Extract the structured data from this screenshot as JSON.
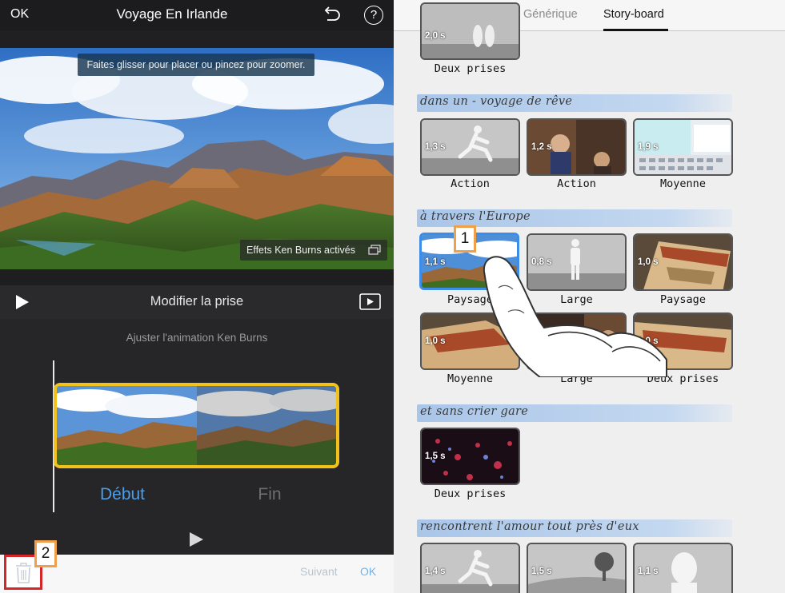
{
  "left": {
    "ok_label": "OK",
    "title": "Voyage En Irlande",
    "hint": "Faites glisser pour placer ou pincez pour zoomer.",
    "kenburns_label": "Effets Ken Burns activés",
    "modify_title": "Modifier la prise",
    "adjust_label": "Ajuster l'animation Ken Burns",
    "debut_label": "Début",
    "fin_label": "Fin",
    "suivant_label": "Suivant",
    "ok2_label": "OK",
    "icons": [
      "undo-icon",
      "help-icon",
      "play-icon",
      "video-preview-icon",
      "layers-icon",
      "trash-icon"
    ]
  },
  "callouts": {
    "one": "1",
    "two": "2"
  },
  "right": {
    "tab_generique": "Générique",
    "tab_storyboard": "Story-board",
    "sections": [
      {
        "title": "dans un - voyage de rêve"
      },
      {
        "title": "à travers l'Europe"
      },
      {
        "title": "et sans crier gare"
      },
      {
        "title": "rencontrent l'amour tout près d'eux"
      }
    ],
    "tiles": [
      {
        "dur": "2,0 s",
        "label": "Deux prises"
      },
      {
        "dur": "1,3 s",
        "label": "Action"
      },
      {
        "dur": "1,2 s",
        "label": "Action"
      },
      {
        "dur": "1,9 s",
        "label": "Moyenne"
      },
      {
        "dur": "1,1 s",
        "label": "Paysage"
      },
      {
        "dur": "0,8 s",
        "label": "Large"
      },
      {
        "dur": "1,0 s",
        "label": "Paysage"
      },
      {
        "dur": "1,0 s",
        "label": "Moyenne"
      },
      {
        "dur": "",
        "label": "Large"
      },
      {
        "dur": "1,0 s",
        "label": "Deux prises"
      },
      {
        "dur": "1,5 s",
        "label": "Deux prises"
      },
      {
        "dur": "1,4 s",
        "label": ""
      },
      {
        "dur": "1,5 s",
        "label": ""
      },
      {
        "dur": "1,1 s",
        "label": ""
      }
    ]
  }
}
